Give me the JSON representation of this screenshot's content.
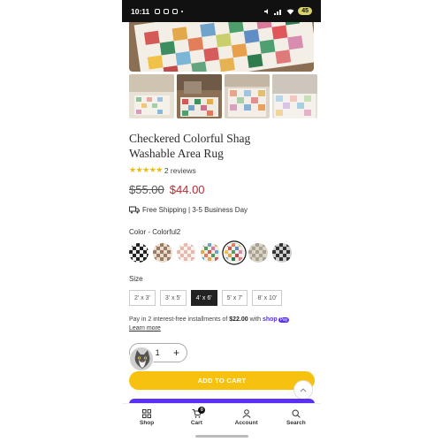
{
  "status_bar": {
    "time": "10:11",
    "battery": "45"
  },
  "product": {
    "title_line1": "Checkered Colorful Shag",
    "title_line2": "Washable Area Rug",
    "rating": {
      "stars": 5,
      "reviews_label": "2 reviews"
    },
    "old_price": "$55.00",
    "new_price": "$44.00",
    "shipping": "Free Shipping | 3-5 Business Day",
    "color_label": "Color - Colorful2",
    "size_label": "Size",
    "sizes": [
      "2' x 3'",
      "3' x 5'",
      "4' x 6'",
      "5' x 7'",
      "8' x 10'"
    ],
    "selected_size": "4' x 6'",
    "pay_text_prefix": "Pay in 2 interest-free installments of ",
    "pay_amount": "$22.00",
    "pay_text_suffix": " with ",
    "shop_label": "shop",
    "shop_pay_badge": "Pay",
    "learn_more": "Learn more",
    "quantity": "1",
    "add_to_cart": "ADD TO CART"
  },
  "nav": {
    "shop": "Shop",
    "cart": "Cart",
    "cart_count": "0",
    "account": "Account",
    "search": "Search"
  },
  "colors": {
    "accent_red": "#c3262c",
    "add_to_cart_yellow": "#f7c20f",
    "shop_pay_purple": "#5a31f4",
    "star_gold": "#f0b90b"
  }
}
